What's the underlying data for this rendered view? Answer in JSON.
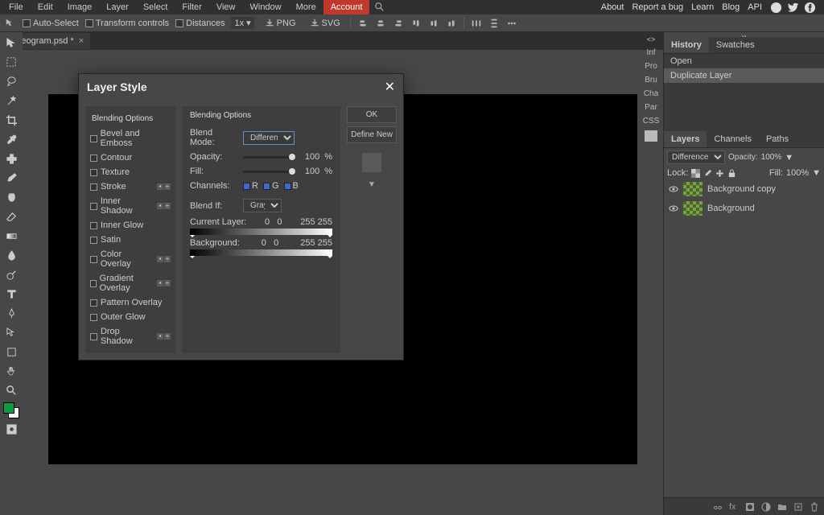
{
  "menu": {
    "items": [
      "File",
      "Edit",
      "Image",
      "Layer",
      "Select",
      "Filter",
      "View",
      "Window",
      "More"
    ],
    "account": "Account",
    "right": [
      "About",
      "Report a bug",
      "Learn",
      "Blog",
      "API"
    ]
  },
  "options": {
    "auto_select": "Auto-Select",
    "transform": "Transform controls",
    "distances": "Distances",
    "zoom": "1x",
    "png": "PNG",
    "svg": "SVG"
  },
  "tab": {
    "name": "stereogram.psd *"
  },
  "inspector": {
    "tags": [
      "Inf",
      "Pro",
      "Bru",
      "Cha",
      "Par",
      "CSS"
    ]
  },
  "history": {
    "tabs": [
      "History",
      "Swatches"
    ],
    "items": [
      "Open",
      "Duplicate Layer"
    ]
  },
  "layers": {
    "tabs": [
      "Layers",
      "Channels",
      "Paths"
    ],
    "blend": "Difference",
    "opacity_label": "Opacity:",
    "opacity": "100%",
    "lock": "Lock:",
    "fill_label": "Fill:",
    "fill": "100%",
    "items": [
      {
        "name": "Background copy"
      },
      {
        "name": "Background"
      }
    ]
  },
  "dialog": {
    "title": "Layer Style",
    "left_title": "Blending Options",
    "effects": [
      {
        "name": "Bevel and Emboss",
        "add": false
      },
      {
        "name": "Contour",
        "add": false
      },
      {
        "name": "Texture",
        "add": false
      },
      {
        "name": "Stroke",
        "add": true
      },
      {
        "name": "Inner Shadow",
        "add": true
      },
      {
        "name": "Inner Glow",
        "add": false
      },
      {
        "name": "Satin",
        "add": false
      },
      {
        "name": "Color Overlay",
        "add": true
      },
      {
        "name": "Gradient Overlay",
        "add": true
      },
      {
        "name": "Pattern Overlay",
        "add": false
      },
      {
        "name": "Outer Glow",
        "add": false
      },
      {
        "name": "Drop Shadow",
        "add": true
      }
    ],
    "mid": {
      "title": "Blending Options",
      "blend_mode_label": "Blend Mode:",
      "blend_mode": "Difference",
      "opacity_label": "Opacity:",
      "opacity": "100",
      "pct": "%",
      "fill_label": "Fill:",
      "fill": "100",
      "channels_label": "Channels:",
      "channels": [
        "R",
        "G",
        "B"
      ],
      "blend_if_label": "Blend If:",
      "blend_if": "Gray",
      "current_label": "Current Layer:",
      "current": [
        "0",
        "0",
        "255",
        "255"
      ],
      "bg_label": "Background:",
      "bg": [
        "0",
        "0",
        "255",
        "255"
      ]
    },
    "buttons": {
      "ok": "OK",
      "define": "Define New"
    }
  }
}
